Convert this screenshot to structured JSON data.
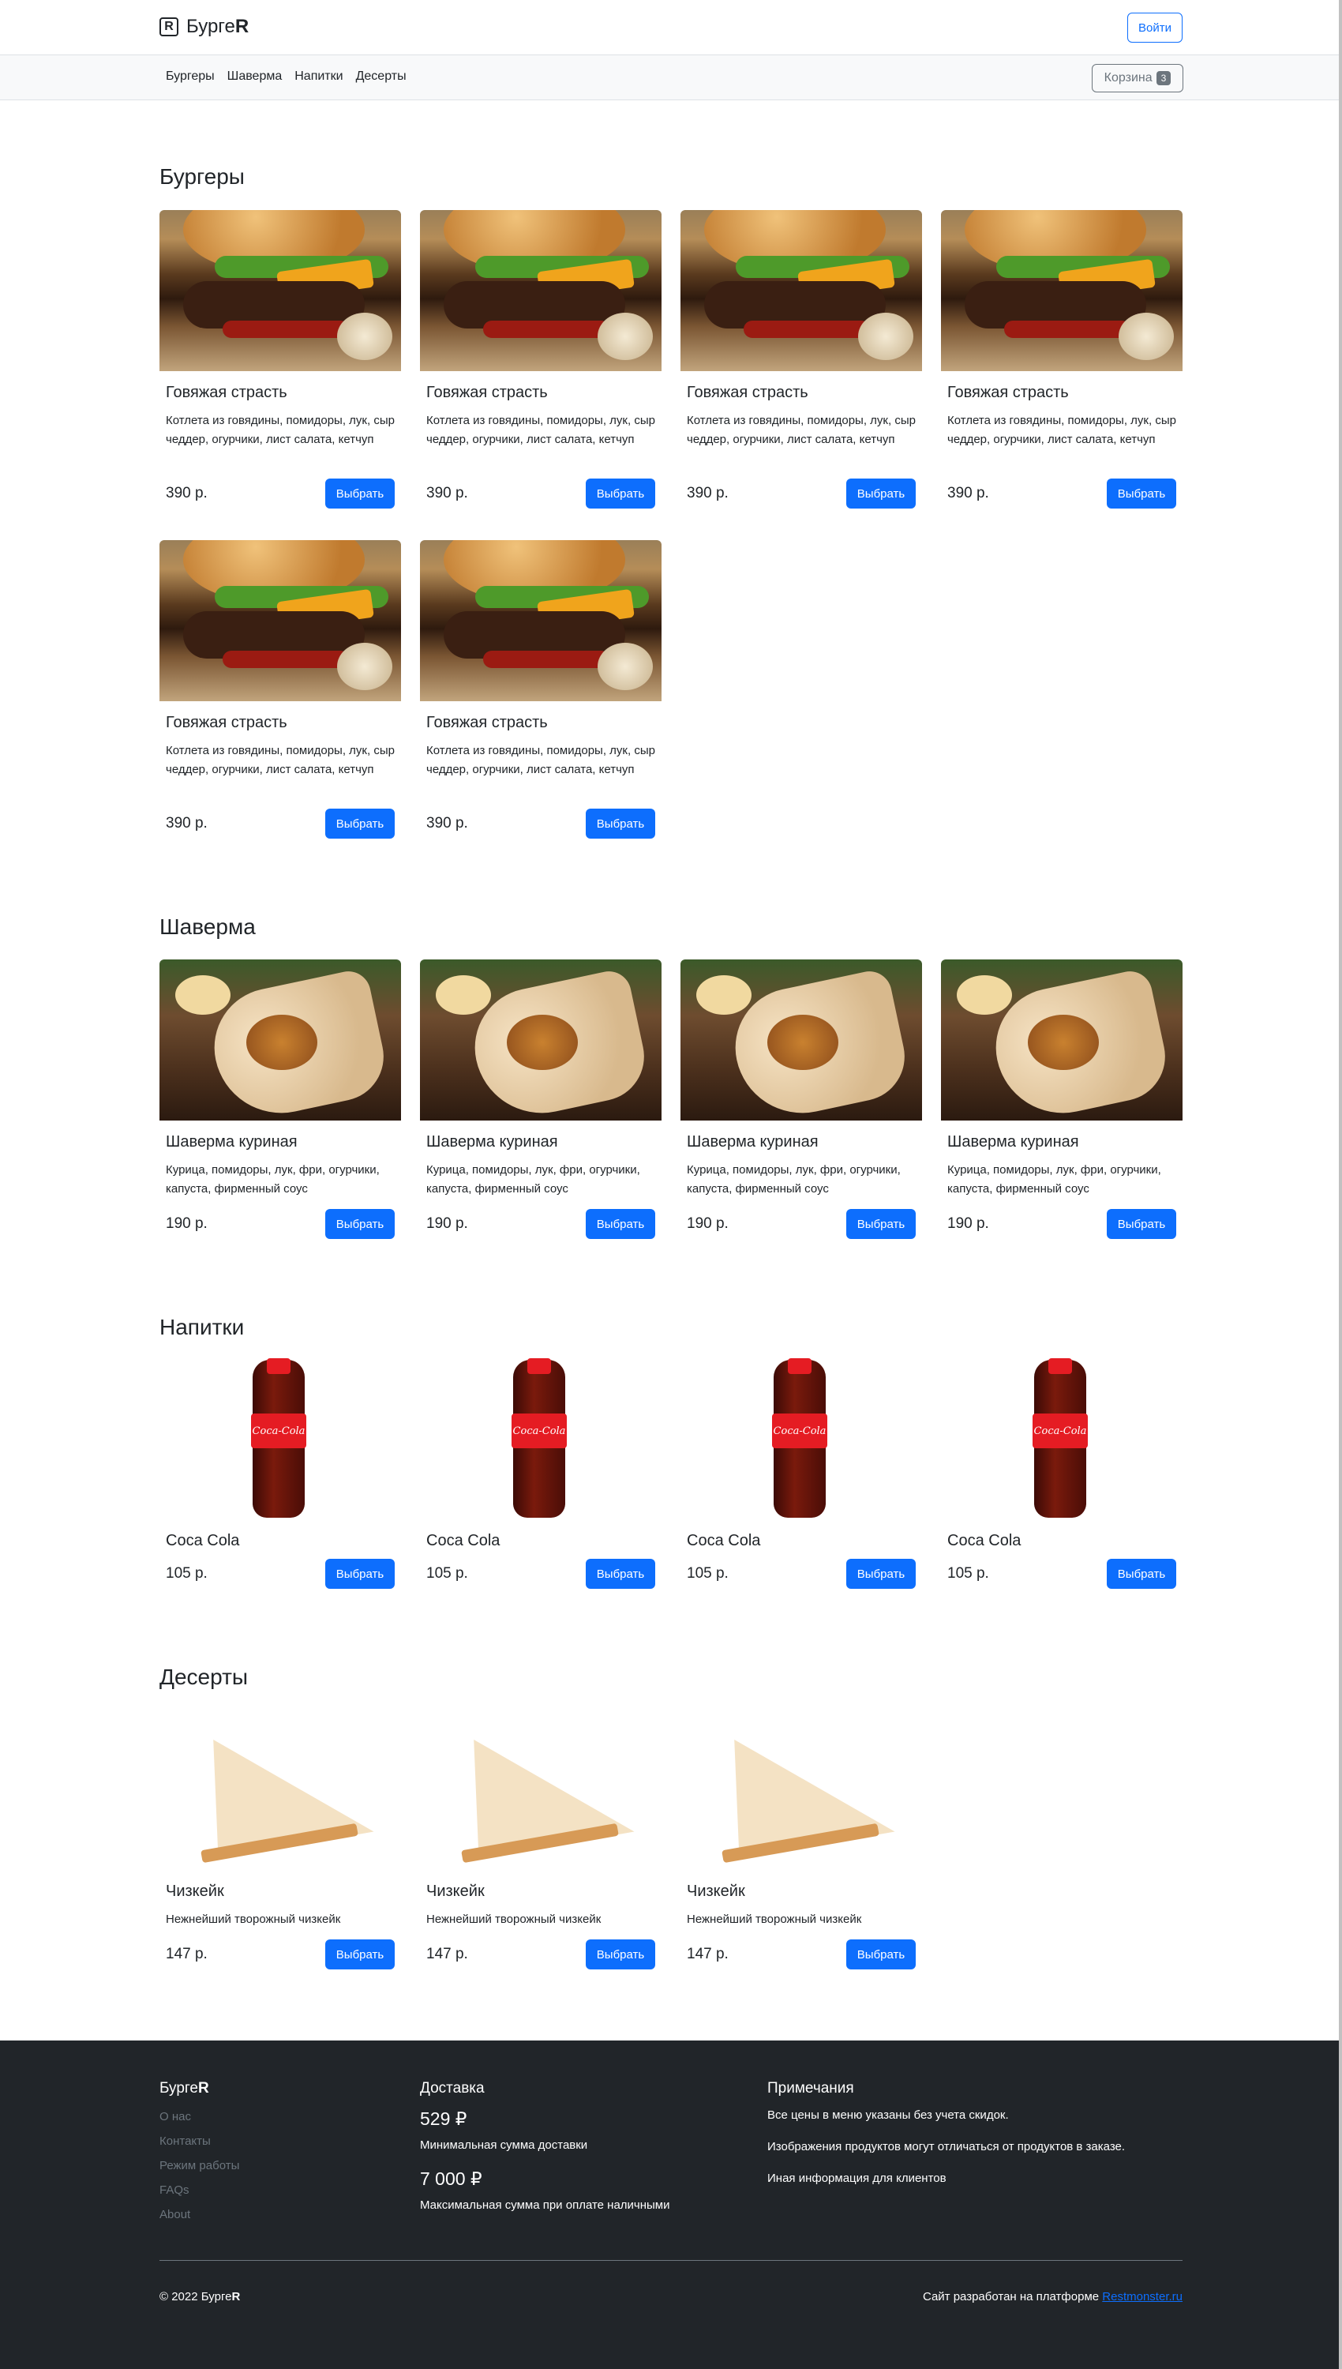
{
  "header": {
    "brand_prefix": "Бурге",
    "brand_suffix": "R",
    "brand_icon": "R",
    "login_label": "Войти"
  },
  "nav": {
    "links": [
      "Бургеры",
      "Шаверма",
      "Напитки",
      "Десерты"
    ],
    "cart_label": "Корзина",
    "cart_count": "3"
  },
  "sections": {
    "burgers": {
      "title": "Бургеры",
      "items": [
        {
          "name": "Говяжая страсть",
          "desc": "Котлета из говядины, помидоры, лук, сыр чеддер, огурчики, лист салата, кетчуп",
          "price": "390 р.",
          "button": "Выбрать"
        },
        {
          "name": "Говяжая страсть",
          "desc": "Котлета из говядины, помидоры, лук, сыр чеддер, огурчики, лист салата, кетчуп",
          "price": "390 р.",
          "button": "Выбрать"
        },
        {
          "name": "Говяжая страсть",
          "desc": "Котлета из говядины, помидоры, лук, сыр чеддер, огурчики, лист салата, кетчуп",
          "price": "390 р.",
          "button": "Выбрать"
        },
        {
          "name": "Говяжая страсть",
          "desc": "Котлета из говядины, помидоры, лук, сыр чеддер, огурчики, лист салата, кетчуп",
          "price": "390 р.",
          "button": "Выбрать"
        },
        {
          "name": "Говяжая страсть",
          "desc": "Котлета из говядины, помидоры, лук, сыр чеддер, огурчики, лист салата, кетчуп",
          "price": "390 р.",
          "button": "Выбрать"
        },
        {
          "name": "Говяжая страсть",
          "desc": "Котлета из говядины, помидоры, лук, сыр чеддер, огурчики, лист салата, кетчуп",
          "price": "390 р.",
          "button": "Выбрать"
        }
      ]
    },
    "shawarma": {
      "title": "Шаверма",
      "items": [
        {
          "name": "Шаверма куриная",
          "desc": "Курица, помидоры, лук, фри, огурчики, капуста, фирменный соус",
          "price": "190 р.",
          "button": "Выбрать"
        },
        {
          "name": "Шаверма куриная",
          "desc": "Курица, помидоры, лук, фри, огурчики, капуста, фирменный соус",
          "price": "190 р.",
          "button": "Выбрать"
        },
        {
          "name": "Шаверма куриная",
          "desc": "Курица, помидоры, лук, фри, огурчики, капуста, фирменный соус",
          "price": "190 р.",
          "button": "Выбрать"
        },
        {
          "name": "Шаверма куриная",
          "desc": "Курица, помидоры, лук, фри, огурчики, капуста, фирменный соус",
          "price": "190 р.",
          "button": "Выбрать"
        }
      ]
    },
    "drinks": {
      "title": "Напитки",
      "items": [
        {
          "name": "Coca Cola",
          "price": "105 р.",
          "button": "Выбрать",
          "label": "Coca-Cola"
        },
        {
          "name": "Coca Cola",
          "price": "105 р.",
          "button": "Выбрать",
          "label": "Coca-Cola"
        },
        {
          "name": "Coca Cola",
          "price": "105 р.",
          "button": "Выбрать",
          "label": "Coca-Cola"
        },
        {
          "name": "Coca Cola",
          "price": "105 р.",
          "button": "Выбрать",
          "label": "Coca-Cola"
        }
      ]
    },
    "desserts": {
      "title": "Десерты",
      "items": [
        {
          "name": "Чизкейк",
          "desc": "Нежнейший творожный чизкейк",
          "price": "147 р.",
          "button": "Выбрать"
        },
        {
          "name": "Чизкейк",
          "desc": "Нежнейший творожный чизкейк",
          "price": "147 р.",
          "button": "Выбрать"
        },
        {
          "name": "Чизкейк",
          "desc": "Нежнейший творожный чизкейк",
          "price": "147 р.",
          "button": "Выбрать"
        }
      ]
    }
  },
  "footer": {
    "brand_prefix": "Бурге",
    "brand_suffix": "R",
    "links": [
      "О нас",
      "Контакты",
      "Режим работы",
      "FAQs",
      "About"
    ],
    "delivery_title": "Доставка",
    "min_amount": "529 ₽",
    "min_amount_note": "Минимальная сумма доставки",
    "max_amount": "7 000 ₽",
    "max_amount_note": "Максимальная сумма при оплате наличными",
    "notes_title": "Примечания",
    "notes": [
      "Все цены в меню указаны без учета скидок.",
      "Изображения продуктов могут отличаться от продуктов в заказе.",
      "Иная информация для клиентов"
    ],
    "copyright_prefix": "© 2022 Бурге",
    "copyright_suffix": "R",
    "credit_text": "Сайт разработан на платформе",
    "credit_link": "Restmonster.ru"
  },
  "colors": {
    "primary": "#0d6efd",
    "footer_bg": "#212529",
    "muted": "#6c757d",
    "nav_bg": "#f8f9fa"
  }
}
